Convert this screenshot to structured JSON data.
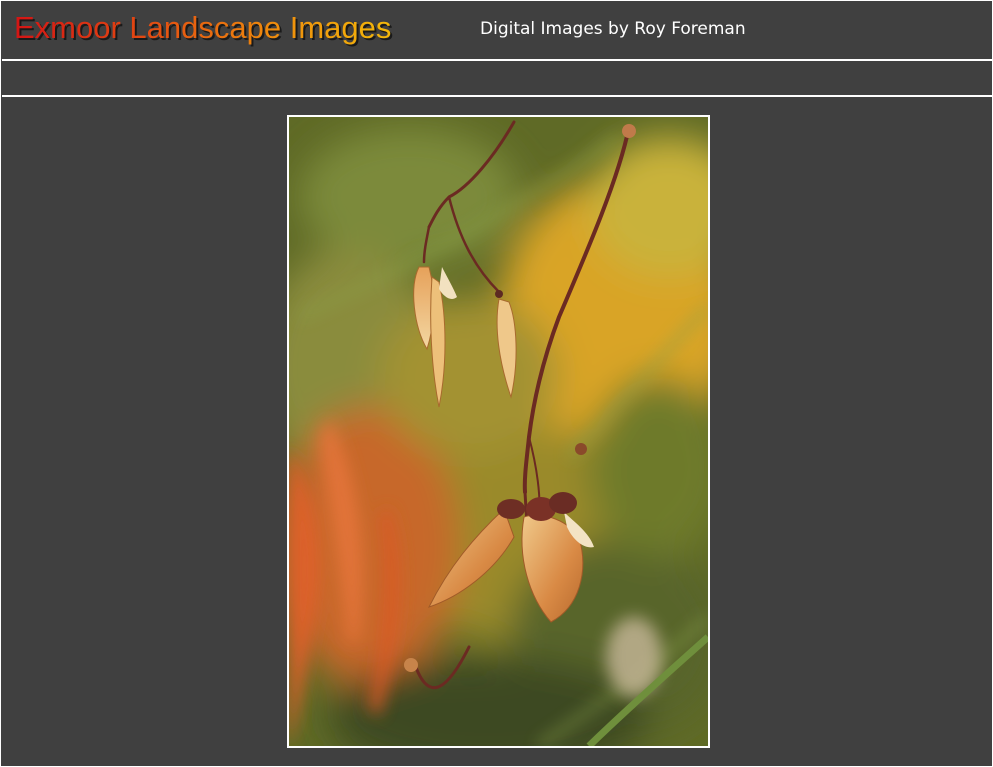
{
  "header": {
    "title": "Exmoor Landscape Images",
    "subtitle": "Digital Images by Roy Foreman"
  },
  "photo": {
    "icon": "photo-image"
  },
  "colors": {
    "background": "#404040",
    "rule": "#ffffff",
    "title_gradient_start": "#d41414",
    "title_gradient_end": "#f3b80a",
    "subtitle": "#ffffff"
  }
}
